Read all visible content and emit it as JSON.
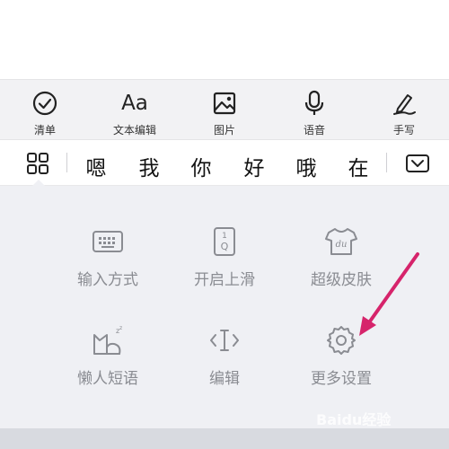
{
  "toolbar": {
    "items": [
      {
        "label": "清单",
        "icon": "checklist-icon"
      },
      {
        "label": "文本编辑",
        "glyph": "Aa",
        "icon": "text-edit-icon"
      },
      {
        "label": "图片",
        "icon": "image-icon"
      },
      {
        "label": "语音",
        "icon": "microphone-icon"
      },
      {
        "label": "手写",
        "icon": "handwriting-pen-icon"
      }
    ]
  },
  "candidates": {
    "words": [
      "嗯",
      "我",
      "你",
      "好",
      "哦",
      "在"
    ],
    "menu_icon": "grid-menu-icon",
    "collapse_icon": "collapse-keyboard-icon"
  },
  "panel": {
    "items": [
      {
        "label": "输入方式",
        "icon": "keyboard-icon"
      },
      {
        "label": "开启上滑",
        "glyph": "1Q",
        "icon": "swipe-up-key-icon"
      },
      {
        "label": "超级皮肤",
        "glyph": "du",
        "icon": "skin-shirt-icon"
      },
      {
        "label": "懒人短语",
        "icon": "lazy-cat-icon"
      },
      {
        "label": "编辑",
        "icon": "text-cursor-icon"
      },
      {
        "label": "更多设置",
        "icon": "gear-icon"
      }
    ]
  },
  "annotation_color": "#d6246b",
  "watermark": "Baidu经验"
}
